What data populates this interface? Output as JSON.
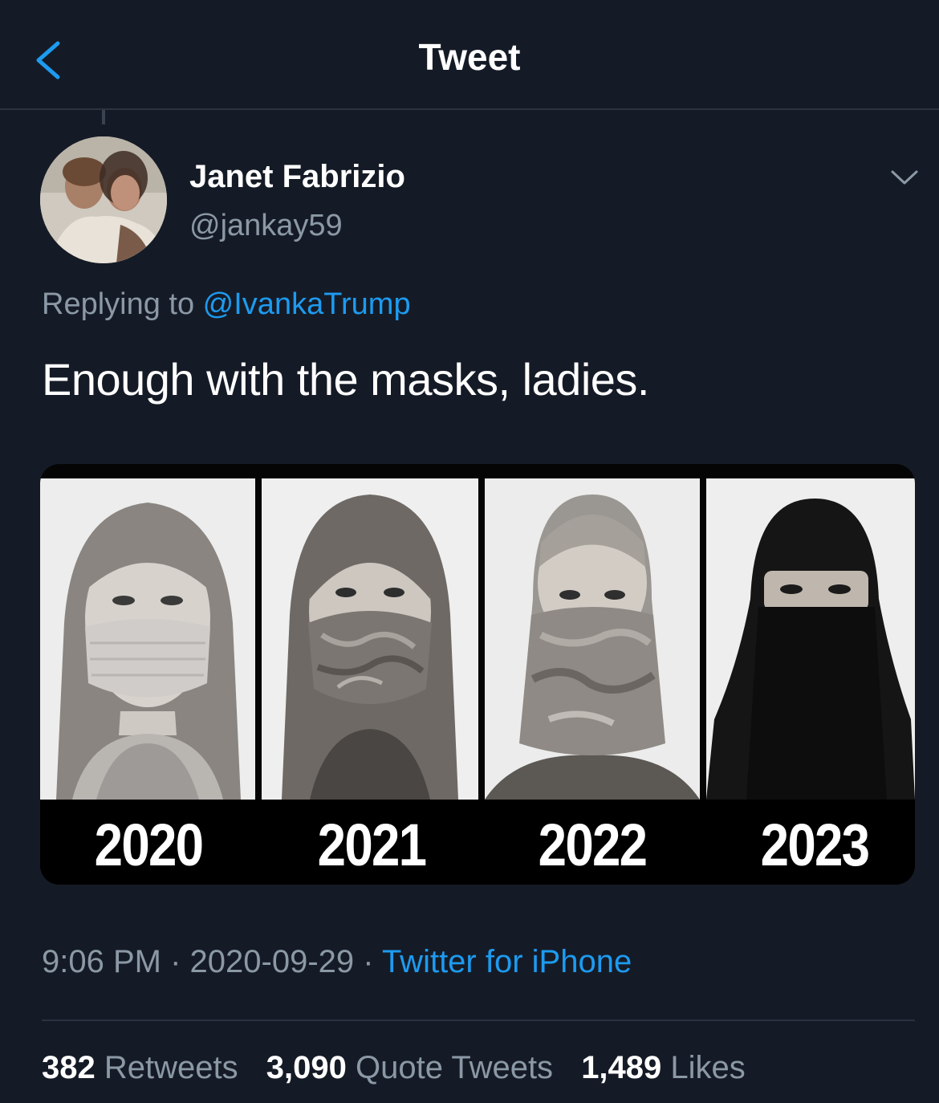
{
  "header": {
    "title": "Tweet"
  },
  "author": {
    "name": "Janet Fabrizio",
    "handle": "@jankay59"
  },
  "reply": {
    "prefix": "Replying to ",
    "mention": "@IvankaTrump"
  },
  "tweet": {
    "text": "Enough with the masks, ladies."
  },
  "media": {
    "panels": [
      {
        "year": "2020"
      },
      {
        "year": "2021"
      },
      {
        "year": "2022"
      },
      {
        "year": "2023"
      }
    ]
  },
  "meta": {
    "time": "9:06 PM",
    "sep1": " · ",
    "date": "2020-09-29",
    "sep2": " · ",
    "source": "Twitter for iPhone"
  },
  "stats": {
    "retweets_count": "382",
    "retweets_label": "Retweets",
    "quotes_count": "3,090",
    "quotes_label": "Quote Tweets",
    "likes_count": "1,489",
    "likes_label": "Likes"
  },
  "colors": {
    "background": "#151b26",
    "accent": "#1d9bf0",
    "muted": "#8b98a6"
  },
  "icons": {
    "back": "chevron-left-icon",
    "more": "chevron-down-icon"
  }
}
